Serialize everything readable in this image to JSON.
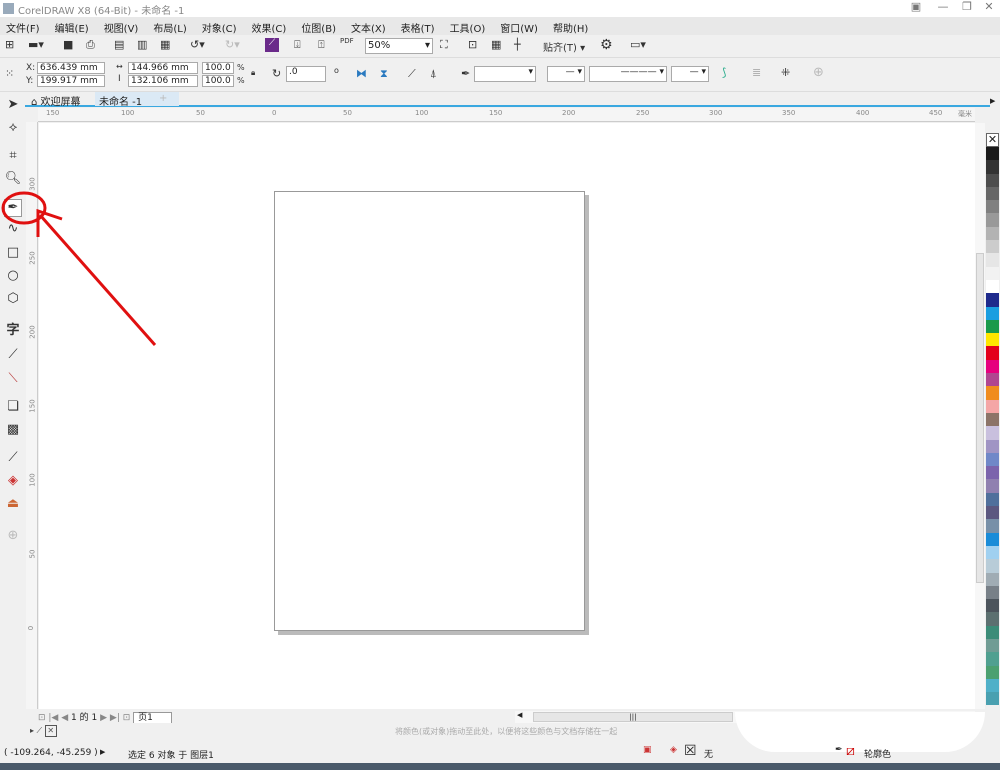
{
  "window": {
    "title": "CorelDRAW X8 (64-Bit) - 未命名 -1"
  },
  "menu": [
    "文件(F)",
    "编辑(E)",
    "视图(V)",
    "布局(L)",
    "对象(C)",
    "效果(C)",
    "位图(B)",
    "文本(X)",
    "表格(T)",
    "工具(O)",
    "窗口(W)",
    "帮助(H)"
  ],
  "toolbar": {
    "zoom": "50%",
    "snap_label": "贴齐(T)",
    "pdf_label": "PDF"
  },
  "property_bar": {
    "x": "636.439 mm",
    "y": "199.917 mm",
    "x_label": "X:",
    "y_label": "Y:",
    "width": "144.966 mm",
    "height": "132.106 mm",
    "scale_w": "100.0",
    "scale_h": "100.0",
    "pct": "%",
    "rotation": ".0"
  },
  "tabs": [
    {
      "label": "欢迎屏幕",
      "icon": "home-icon"
    },
    {
      "label": "未命名 -1",
      "active": true
    }
  ],
  "rulers": {
    "unit": "毫米",
    "top": [
      "150",
      "100",
      "50",
      "0",
      "50",
      "100",
      "150",
      "200",
      "250",
      "300",
      "350",
      "400",
      "450"
    ],
    "left": [
      "300",
      "250",
      "200",
      "150",
      "100",
      "50",
      "0"
    ]
  },
  "page_nav": {
    "current": "1",
    "of": "的",
    "total": "1",
    "page_tab": "页1"
  },
  "doc_palette_hint": "将颜色(或对象)拖动至此处，以便将这些颜色与文档存储在一起",
  "status": {
    "coords": "( -109.264, -45.259 )",
    "selection": "选定 6 对象 于 图层1",
    "fill": "无",
    "outline": "轮廓色"
  },
  "highlight_color": "#e01010",
  "accent_color": "#3aa8e0",
  "palette": [
    "#1a1a1a",
    "#333333",
    "#4d4d4d",
    "#666666",
    "#808080",
    "#999999",
    "#b3b3b3",
    "#cccccc",
    "#e6e6e6",
    "#f2f2f2",
    "#ffffff",
    "#1e2a8c",
    "#1a9ee0",
    "#1a9a4a",
    "#ffe600",
    "#e3001b",
    "#e6007e",
    "#b04690",
    "#f08c1e",
    "#f4a6a6",
    "#8c7468",
    "#c9c0de",
    "#a094c4",
    "#7088c8",
    "#7c64ac",
    "#9080b0",
    "#50709c",
    "#5c5880",
    "#7890a8",
    "#1a8cd8",
    "#a0d0f0",
    "#b8ccd8",
    "#a0acb4",
    "#788088",
    "#4c545c",
    "#5c7070",
    "#3c8c78",
    "#709c94",
    "#50a090",
    "#4ca070",
    "#50b0c8",
    "#4aa0b0"
  ]
}
